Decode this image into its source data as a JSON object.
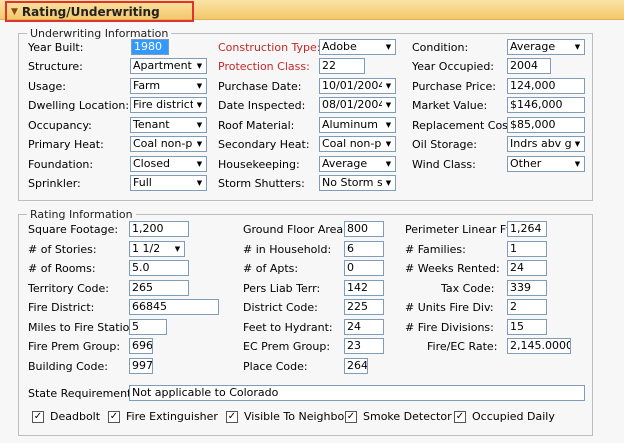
{
  "header": {
    "title": "Rating/Underwriting"
  },
  "uw": {
    "legend": "Underwriting Information",
    "year_built": {
      "label": "Year Built:",
      "value": "1980"
    },
    "structure": {
      "label": "Structure:",
      "value": "Apartment"
    },
    "usage": {
      "label": "Usage:",
      "value": "Farm"
    },
    "dwelling_location": {
      "label": "Dwelling Location:",
      "value": "Fire district"
    },
    "occupancy": {
      "label": "Occupancy:",
      "value": "Tenant"
    },
    "primary_heat": {
      "label": "Primary Heat:",
      "value": "Coal non-pro"
    },
    "foundation": {
      "label": "Foundation:",
      "value": "Closed"
    },
    "sprinkler": {
      "label": "Sprinkler:",
      "value": "Full"
    },
    "construction_type": {
      "label": "Construction Type:",
      "value": "Adobe"
    },
    "protection_class": {
      "label": "Protection Class:",
      "value": "22"
    },
    "purchase_date": {
      "label": "Purchase Date:",
      "value": "10/01/2004"
    },
    "date_inspected": {
      "label": "Date Inspected:",
      "value": "08/01/2004"
    },
    "roof_material": {
      "label": "Roof Material:",
      "value": "Aluminum sh"
    },
    "secondary_heat": {
      "label": "Secondary Heat:",
      "value": "Coal non-pro"
    },
    "housekeeping": {
      "label": "Housekeeping:",
      "value": "Average"
    },
    "storm_shutters": {
      "label": "Storm Shutters:",
      "value": "No Storm sh"
    },
    "condition": {
      "label": "Condition:",
      "value": "Average"
    },
    "year_occupied": {
      "label": "Year Occupied:",
      "value": "2004"
    },
    "purchase_price": {
      "label": "Purchase Price:",
      "value": "124,000"
    },
    "market_value": {
      "label": "Market Value:",
      "value": "$146,000"
    },
    "replacement_cost": {
      "label": "Replacement Cost:",
      "value": "$85,000"
    },
    "oil_storage": {
      "label": "Oil Storage:",
      "value": "Indrs abv gr"
    },
    "wind_class": {
      "label": "Wind Class:",
      "value": "Other"
    }
  },
  "rating": {
    "legend": "Rating Information",
    "square_footage": {
      "label": "Square Footage:",
      "value": "1,200"
    },
    "stories": {
      "label": "# of Stories:",
      "value": "1 1/2"
    },
    "rooms": {
      "label": "# of Rooms:",
      "value": "5.0"
    },
    "territory_code": {
      "label": "Territory Code:",
      "value": "265"
    },
    "fire_district": {
      "label": "Fire District:",
      "value": "66845"
    },
    "miles_to_station": {
      "label": "Miles to Fire Station:",
      "value": "5"
    },
    "fire_prem_group": {
      "label": "Fire Prem Group:",
      "value": "696"
    },
    "building_code": {
      "label": "Building Code:",
      "value": "997"
    },
    "ground_floor_area": {
      "label": "Ground Floor Area:",
      "value": "800"
    },
    "in_household": {
      "label": "# in Household:",
      "value": "6"
    },
    "apts": {
      "label": "# of Apts:",
      "value": "0"
    },
    "pers_liab_terr": {
      "label": "Pers Liab Terr:",
      "value": "142"
    },
    "district_code": {
      "label": "District Code:",
      "value": "225"
    },
    "feet_to_hydrant": {
      "label": "Feet to Hydrant:",
      "value": "24"
    },
    "ec_prem_group": {
      "label": "EC Prem Group:",
      "value": "23"
    },
    "place_code": {
      "label": "Place Code:",
      "value": "264"
    },
    "perimeter": {
      "label": "Perimeter Linear Ft.:",
      "value": "1,264"
    },
    "families": {
      "label": "# Families:",
      "value": "1"
    },
    "weeks_rented": {
      "label": "# Weeks Rented:",
      "value": "24"
    },
    "tax_code": {
      "label": "Tax Code:",
      "value": "339"
    },
    "units_fire_div": {
      "label": "# Units Fire Div:",
      "value": "2"
    },
    "fire_divisions": {
      "label": "# Fire Divisions:",
      "value": "15"
    },
    "fire_ec_rate": {
      "label": "Fire/EC Rate:",
      "value": "2,145.00000"
    },
    "state_requirement": {
      "label": "State Requirement:",
      "value": "Not applicable to Colorado"
    }
  },
  "checkboxes": [
    {
      "label": "Deadbolt",
      "checked": true,
      "mark": "✓"
    },
    {
      "label": "Fire Extinguisher",
      "checked": true,
      "mark": "✓"
    },
    {
      "label": "Visible To Neighbor",
      "checked": true,
      "mark": "✓"
    },
    {
      "label": "Smoke Detector",
      "checked": true,
      "mark": "✓"
    },
    {
      "label": "Occupied Daily",
      "checked": true,
      "mark": "✓"
    }
  ]
}
